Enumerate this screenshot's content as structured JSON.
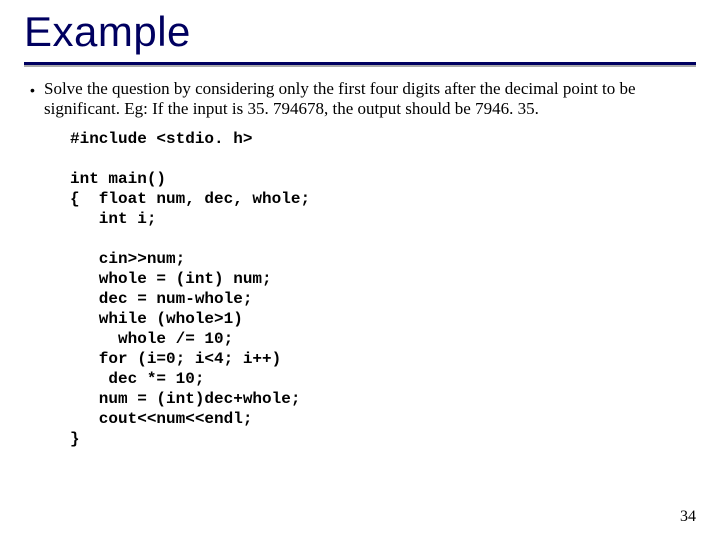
{
  "title": "Example",
  "bullet": "Solve the question by considering only the first four digits after the decimal point to be significant. Eg: If the input is 35. 794678, the output should be 7946. 35.",
  "code": "#include <stdio. h>\n\nint main()\n{  float num, dec, whole;\n   int i;\n\n   cin>>num;\n   whole = (int) num;\n   dec = num-whole;\n   while (whole>1)\n     whole /= 10;\n   for (i=0; i<4; i++)\n    dec *= 10;\n   num = (int)dec+whole;\n   cout<<num<<endl;\n}",
  "page_number": "34"
}
